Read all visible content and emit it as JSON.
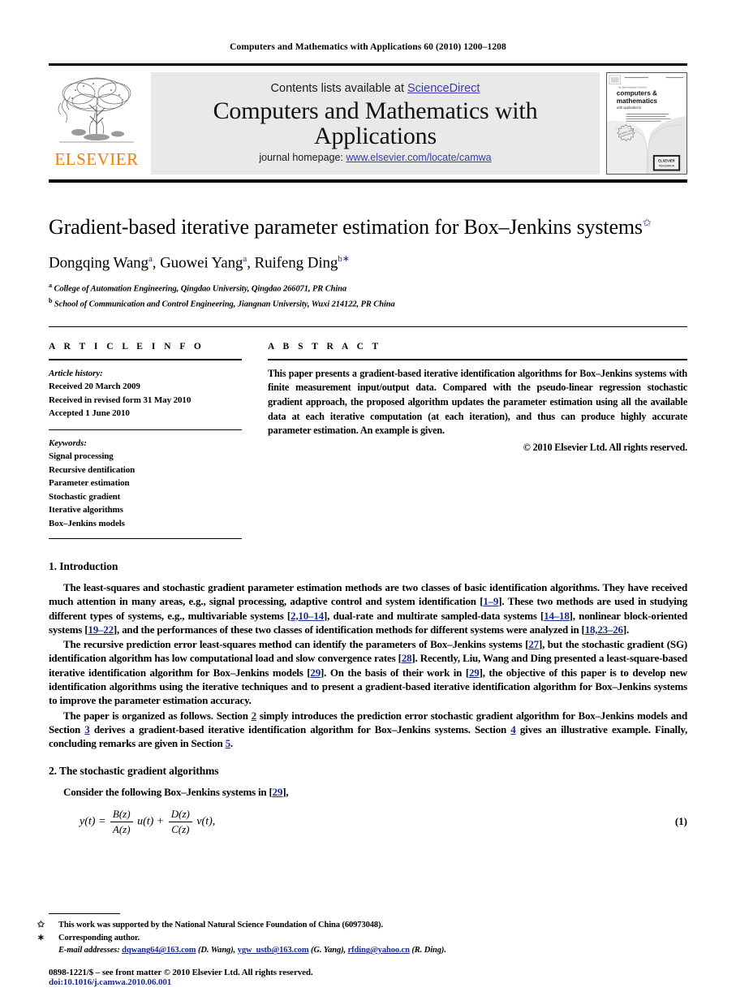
{
  "running_head": "Computers and Mathematics with Applications 60 (2010) 1200–1208",
  "masthead": {
    "publisher_name": "ELSEVIER",
    "contents_prefix": "Contents lists available at ",
    "contents_link": "ScienceDirect",
    "journal_title": "Computers and Mathematics with Applications",
    "homepage_prefix": "journal homepage: ",
    "homepage_link": "www.elsevier.com/locate/camwa",
    "cover_line1": "An International Journal",
    "cover_line2": "computers &",
    "cover_line3": "mathematics",
    "cover_line4": "with applications",
    "accent_orange": "#f07d00",
    "link_blue": "#3b3bb0"
  },
  "article": {
    "title": "Gradient-based iterative parameter estimation for Box–Jenkins systems",
    "title_footnote_mark": "✩",
    "authors": [
      {
        "name": "Dongqing Wang",
        "sup": "a"
      },
      {
        "name": "Guowei Yang",
        "sup": "a"
      },
      {
        "name": "Ruifeng Ding",
        "sup": "b",
        "corresponding": "∗"
      }
    ],
    "affiliations": [
      {
        "mark": "a",
        "text": "College of Automation Engineering, Qingdao University, Qingdao 266071, PR China"
      },
      {
        "mark": "b",
        "text": "School of Communication and Control Engineering, Jiangnan University, Wuxi 214122, PR China"
      }
    ]
  },
  "article_info": {
    "label": "A R T I C L E    I N F O",
    "history_label": "Article history:",
    "history": [
      "Received 20 March 2009",
      "Received in revised form 31 May 2010",
      "Accepted 1 June 2010"
    ],
    "keywords_label": "Keywords:",
    "keywords": [
      "Signal processing",
      "Recursive dentification",
      "Parameter estimation",
      "Stochastic gradient",
      "Iterative algorithms",
      "Box–Jenkins models"
    ]
  },
  "abstract": {
    "label": "A B S T R A C T",
    "text": "This paper presents a gradient-based iterative identification algorithms for Box–Jenkins systems with finite measurement input/output data. Compared with the pseudo-linear regression stochastic gradient approach, the proposed algorithm updates the parameter estimation using all the available data at each iterative computation (at each iteration), and thus can produce highly accurate parameter estimation. An example is given.",
    "copyright": "© 2010 Elsevier Ltd. All rights reserved."
  },
  "sections": {
    "intro_heading": "1. Introduction",
    "intro_p1_a": "The least-squares and stochastic gradient parameter estimation methods are two classes of basic identification algorithms. They have received much attention in many areas, e.g., signal processing, adaptive control and system identification [",
    "intro_p1_cite1": "1–9",
    "intro_p1_b": "]. These two methods are used in studying different types of systems, e.g., multivariable systems [",
    "intro_p1_cite2": "2,10–14",
    "intro_p1_c": "], dual-rate and multirate sampled-data systems [",
    "intro_p1_cite3": "14–18",
    "intro_p1_d": "], nonlinear block-oriented systems [",
    "intro_p1_cite4": "19–22",
    "intro_p1_e": "], and the performances of these two classes of identification methods for different systems were analyzed in [",
    "intro_p1_cite5": "18,23–26",
    "intro_p1_f": "].",
    "intro_p2_a": "The recursive prediction error least-squares method can identify the parameters of Box–Jenkins systems [",
    "intro_p2_cite1": "27",
    "intro_p2_b": "], but the stochastic gradient (SG) identification algorithm has low computational load and slow convergence rates [",
    "intro_p2_cite2": "28",
    "intro_p2_c": "]. Recently, Liu, Wang and Ding presented a least-square-based iterative identification algorithm for Box–Jenkins models [",
    "intro_p2_cite3": "29",
    "intro_p2_d": "]. On the basis of their work in [",
    "intro_p2_cite4": "29",
    "intro_p2_e": "], the objective of this paper is to develop new identification algorithms using the iterative techniques and to present a gradient-based iterative identification algorithm for Box–Jenkins systems to improve the parameter estimation accuracy.",
    "intro_p3_a": "The paper is organized as follows. Section ",
    "intro_p3_s2": "2",
    "intro_p3_b": " simply introduces the prediction error stochastic gradient algorithm for Box–Jenkins models and Section ",
    "intro_p3_s3": "3",
    "intro_p3_c": " derives a gradient-based iterative identification algorithm for Box–Jenkins systems. Section ",
    "intro_p3_s4": "4",
    "intro_p3_d": " gives an illustrative example. Finally, concluding remarks are given in Section ",
    "intro_p3_s5": "5",
    "intro_p3_e": ".",
    "sec2_heading": "2. The stochastic gradient algorithms",
    "sec2_p1_a": "Consider the following Box–Jenkins systems in [",
    "sec2_p1_cite": "29",
    "sec2_p1_b": "],"
  },
  "equation": {
    "lhs": "y(t)",
    "equals": "=",
    "frac1_num": "B(z)",
    "frac1_den": "A(z)",
    "term1": "u(t)",
    "plus": "+",
    "frac2_num": "D(z)",
    "frac2_den": "C(z)",
    "term2": "v(t),",
    "number": "(1)"
  },
  "footnotes": {
    "funding_mark": "✩",
    "funding": "This work was supported by the National Natural Science Foundation of China (60973048).",
    "corresponding_mark": "∗",
    "corresponding": "Corresponding author.",
    "emails_label": "E-mail addresses:",
    "emails": [
      {
        "address": "dqwang64@163.com",
        "who": "(D. Wang)"
      },
      {
        "address": "ygw_ustb@163.com",
        "who": "(G. Yang)"
      },
      {
        "address": "rfding@yahoo.cn",
        "who": "(R. Ding)"
      }
    ],
    "issn_line": "0898-1221/$ – see front matter © 2010 Elsevier Ltd. All rights reserved.",
    "doi_line": "doi:10.1016/j.camwa.2010.06.001"
  }
}
